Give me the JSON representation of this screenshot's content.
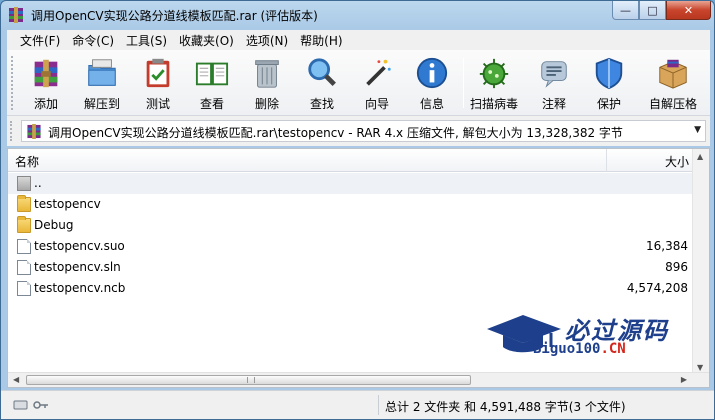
{
  "window": {
    "title": "调用OpenCV实现公路分道线模板匹配.rar (评估版本)",
    "controls": {
      "minimize": "—",
      "maximize": "□",
      "close": "✕"
    }
  },
  "menu": {
    "items": [
      "文件(F)",
      "命令(C)",
      "工具(S)",
      "收藏夹(O)",
      "选项(N)",
      "帮助(H)"
    ]
  },
  "toolbar": {
    "buttons": [
      {
        "label": "添加",
        "icon": "add-archive-icon"
      },
      {
        "label": "解压到",
        "icon": "extract-icon"
      },
      {
        "label": "测试",
        "icon": "test-clipboard-icon"
      },
      {
        "label": "查看",
        "icon": "view-book-icon"
      },
      {
        "label": "删除",
        "icon": "trash-icon"
      },
      {
        "label": "查找",
        "icon": "magnifier-icon"
      },
      {
        "label": "向导",
        "icon": "wizard-wand-icon"
      },
      {
        "label": "信息",
        "icon": "info-icon"
      },
      {
        "label": "扫描病毒",
        "icon": "virus-scan-icon"
      },
      {
        "label": "注释",
        "icon": "comment-icon"
      },
      {
        "label": "保护",
        "icon": "shield-icon"
      },
      {
        "label": "自解压格",
        "icon": "sfx-box-icon"
      }
    ]
  },
  "address": {
    "path": "调用OpenCV实现公路分道线模板匹配.rar\\testopencv - RAR 4.x 压缩文件, 解包大小为 13,328,382 字节",
    "dropdown": "▼"
  },
  "file_list": {
    "columns": {
      "name": "名称",
      "size": "大小"
    },
    "rows": [
      {
        "name": "..",
        "size": "",
        "type": "up"
      },
      {
        "name": "testopencv",
        "size": "",
        "type": "folder"
      },
      {
        "name": "Debug",
        "size": "",
        "type": "folder"
      },
      {
        "name": "testopencv.suo",
        "size": "16,384",
        "type": "file"
      },
      {
        "name": "testopencv.sln",
        "size": "896",
        "type": "file"
      },
      {
        "name": "testopencv.ncb",
        "size": "4,574,208",
        "type": "file"
      }
    ]
  },
  "watermark": {
    "cn": "必过源码",
    "en_main": "Biguo100",
    "en_accent": ".CN"
  },
  "status": {
    "summary": "总计 2 文件夹 和 4,591,488 字节(3 个文件)"
  },
  "colors": {
    "title_gradient": "#bcd7ee",
    "close_red": "#c9452c",
    "folder": "#e9b73a",
    "watermark_blue": "#1e3f8c",
    "watermark_red": "#d5261b"
  }
}
